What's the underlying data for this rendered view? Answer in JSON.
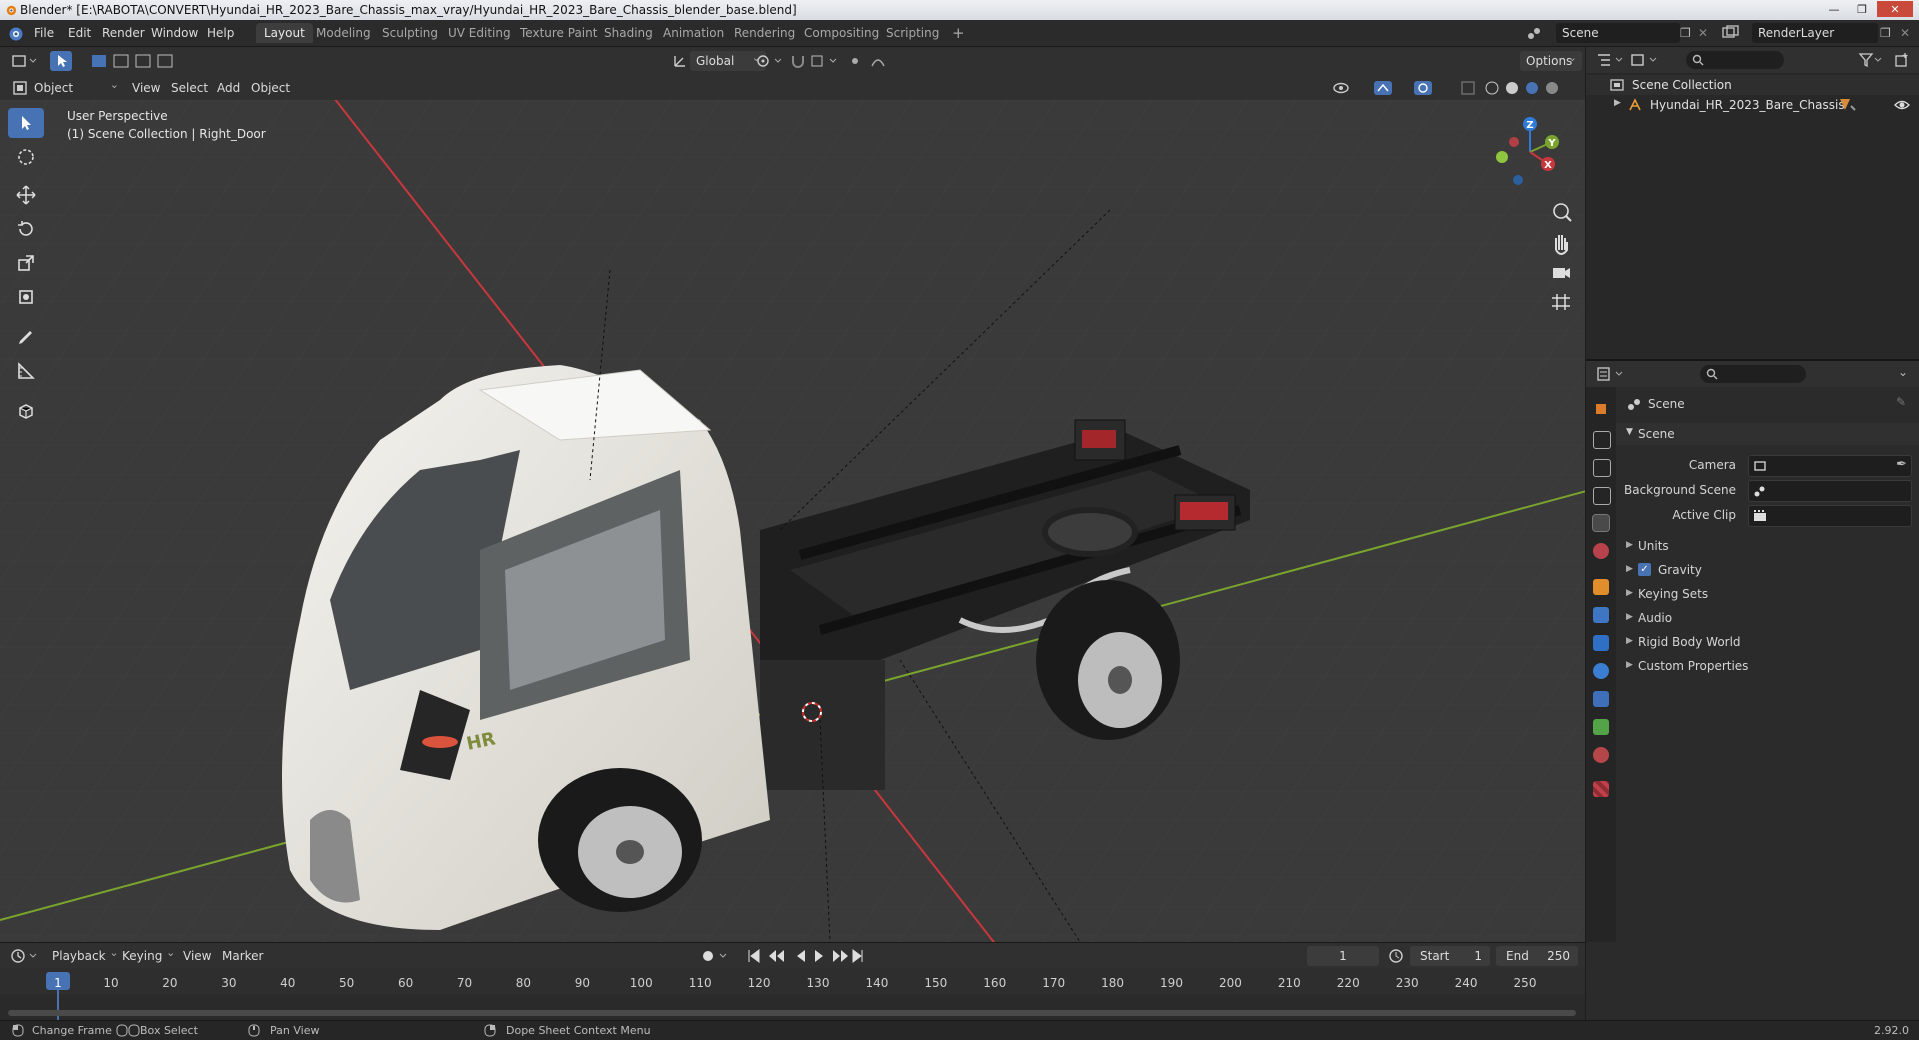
{
  "window": {
    "title": "Blender* [E:\\RABOTA\\CONVERT\\Hyundai_HR_2023_Bare_Chassis_max_vray/Hyundai_HR_2023_Bare_Chassis_blender_base.blend]",
    "controls": [
      "—",
      "❐",
      "✕"
    ]
  },
  "menu": [
    "File",
    "Edit",
    "Render",
    "Window",
    "Help"
  ],
  "workspaces": [
    "Layout",
    "Modeling",
    "Sculpting",
    "UV Editing",
    "Texture Paint",
    "Shading",
    "Animation",
    "Rendering",
    "Compositing",
    "Scripting"
  ],
  "workspace_add": "+",
  "scene_name": "Scene",
  "view_layer": "RenderLayer",
  "toolbar": {
    "transform_orientation": "Global",
    "options_label": "Options"
  },
  "viewport_header": {
    "mode": "Object Mode",
    "menus": [
      "View",
      "Select",
      "Add",
      "Object"
    ]
  },
  "viewport": {
    "perspective_label": "User Perspective",
    "context_label": "(1) Scene Collection | Right_Door",
    "gizmo_axes": {
      "x": "X",
      "y": "Y",
      "z": "Z"
    },
    "badge_text": "HR"
  },
  "outliner": {
    "root": "Scene Collection",
    "items": [
      {
        "name": "Hyundai_HR_2023_Bare_Chassis"
      }
    ]
  },
  "properties": {
    "context_title": "Scene",
    "panel_title": "Scene",
    "fields": [
      {
        "label": "Camera"
      },
      {
        "label": "Background Scene"
      },
      {
        "label": "Active Clip"
      }
    ],
    "collapsed_panels": [
      "Units",
      "Gravity",
      "Keying Sets",
      "Audio",
      "Rigid Body World",
      "Custom Properties"
    ],
    "gravity_checked": true
  },
  "timeline": {
    "menus": [
      "Playback",
      "Keying",
      "View",
      "Marker"
    ],
    "current_frame": "1",
    "start_label": "Start",
    "start_value": "1",
    "end_label": "End",
    "end_value": "250",
    "ticks": [
      "1",
      "10",
      "20",
      "30",
      "40",
      "50",
      "60",
      "70",
      "80",
      "90",
      "100",
      "110",
      "120",
      "130",
      "140",
      "150",
      "160",
      "170",
      "180",
      "190",
      "200",
      "210",
      "220",
      "230",
      "240",
      "250"
    ]
  },
  "status": {
    "items": [
      "Change Frame",
      "Box Select",
      "Pan View",
      "Dope Sheet Context Menu"
    ],
    "version": "2.92.0"
  },
  "colors": {
    "accent": "#4772b3",
    "axis_x": "#c8373d",
    "axis_y": "#7aa42d",
    "axis_z": "#2f7bd8",
    "header": "#303030",
    "viewport_bg": "#3a3a3a"
  }
}
